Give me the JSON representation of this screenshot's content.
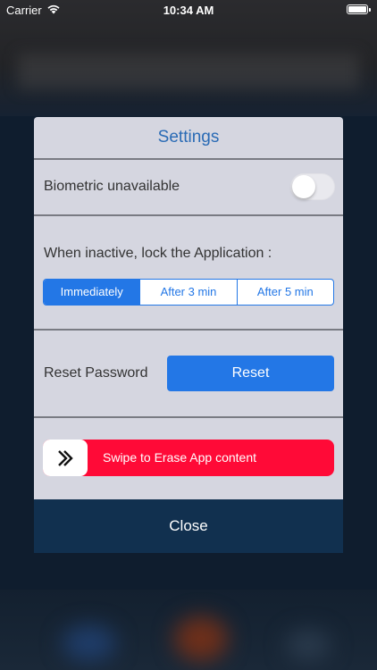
{
  "status_bar": {
    "carrier": "Carrier",
    "time": "10:34 AM",
    "battery_level": 1.0
  },
  "icons": {
    "wifi": "wifi-icon",
    "battery": "battery-icon",
    "swipe": "double-chevron-right-icon"
  },
  "settings": {
    "title": "Settings",
    "biometric": {
      "label": "Biometric unavailable",
      "enabled": false
    },
    "lock": {
      "label": "When inactive, lock the Application :",
      "options": [
        "Immediately",
        "After 3 min",
        "After 5 min"
      ],
      "selected": "Immediately"
    },
    "reset": {
      "label": "Reset Password",
      "button_label": "Reset"
    },
    "erase": {
      "label": "Swipe to Erase App content"
    },
    "close_label": "Close"
  },
  "colors": {
    "accent_blue": "#2377e6",
    "title_blue": "#2a6bb5",
    "erase_red": "#ff0a37",
    "close_navy": "#11304f",
    "panel_gray": "#d5d6e0"
  }
}
